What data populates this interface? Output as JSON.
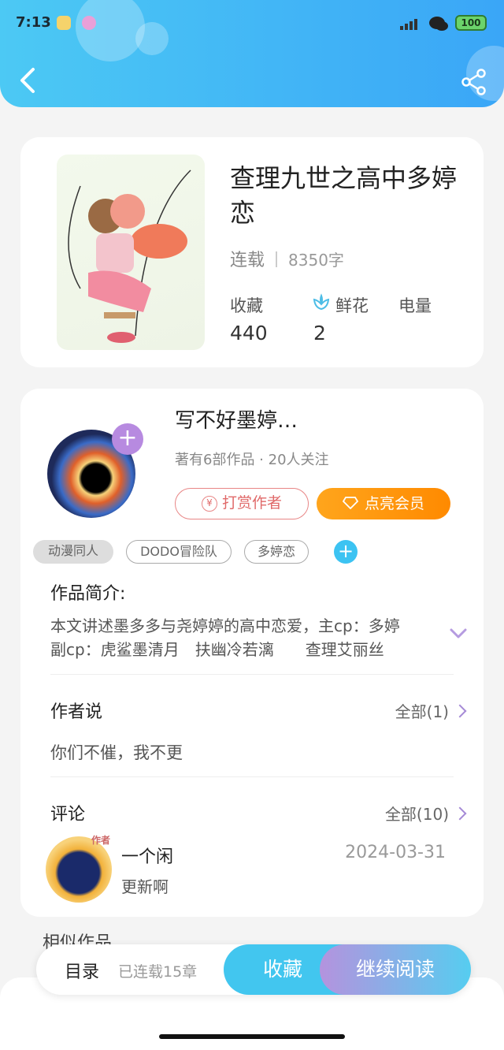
{
  "status_bar": {
    "time": "7:13",
    "battery": "100"
  },
  "book": {
    "title": "查理九世之高中多婷恋",
    "status": "连载",
    "words": "8350字",
    "stats": [
      {
        "label": "收藏",
        "value": "440"
      },
      {
        "label": "鲜花",
        "value": "2"
      },
      {
        "label": "电量",
        "value": ""
      }
    ]
  },
  "author": {
    "name": "写不好墨婷…",
    "meta": "著有6部作品 · 20人关注",
    "tip_label": "打赏作者",
    "tip_icon": "¥",
    "vip_label": "点亮会员"
  },
  "tags": [
    "动漫同人",
    "DODO冒险队",
    "多婷恋"
  ],
  "intro": {
    "title": "作品简介:",
    "line1": "本文讲述墨多多与尧婷婷的高中恋爱，主cp：多婷",
    "line2": "副cp：虎鲨墨清月　扶幽冷若漓　　查理艾丽丝"
  },
  "author_says": {
    "title": "作者说",
    "all_label": "全部(1)",
    "text": "你们不催，我不更"
  },
  "comments": {
    "title": "评论",
    "all_label": "全部(10)",
    "items": [
      {
        "user": "一个闲",
        "date": "2024-03-31",
        "text": "更新啊",
        "badge": "作者"
      }
    ]
  },
  "similar_title": "相似作品",
  "bottom_bar": {
    "toc": "目录",
    "chapters": "已连载15章",
    "collect": "收藏",
    "read": "继续阅读"
  }
}
